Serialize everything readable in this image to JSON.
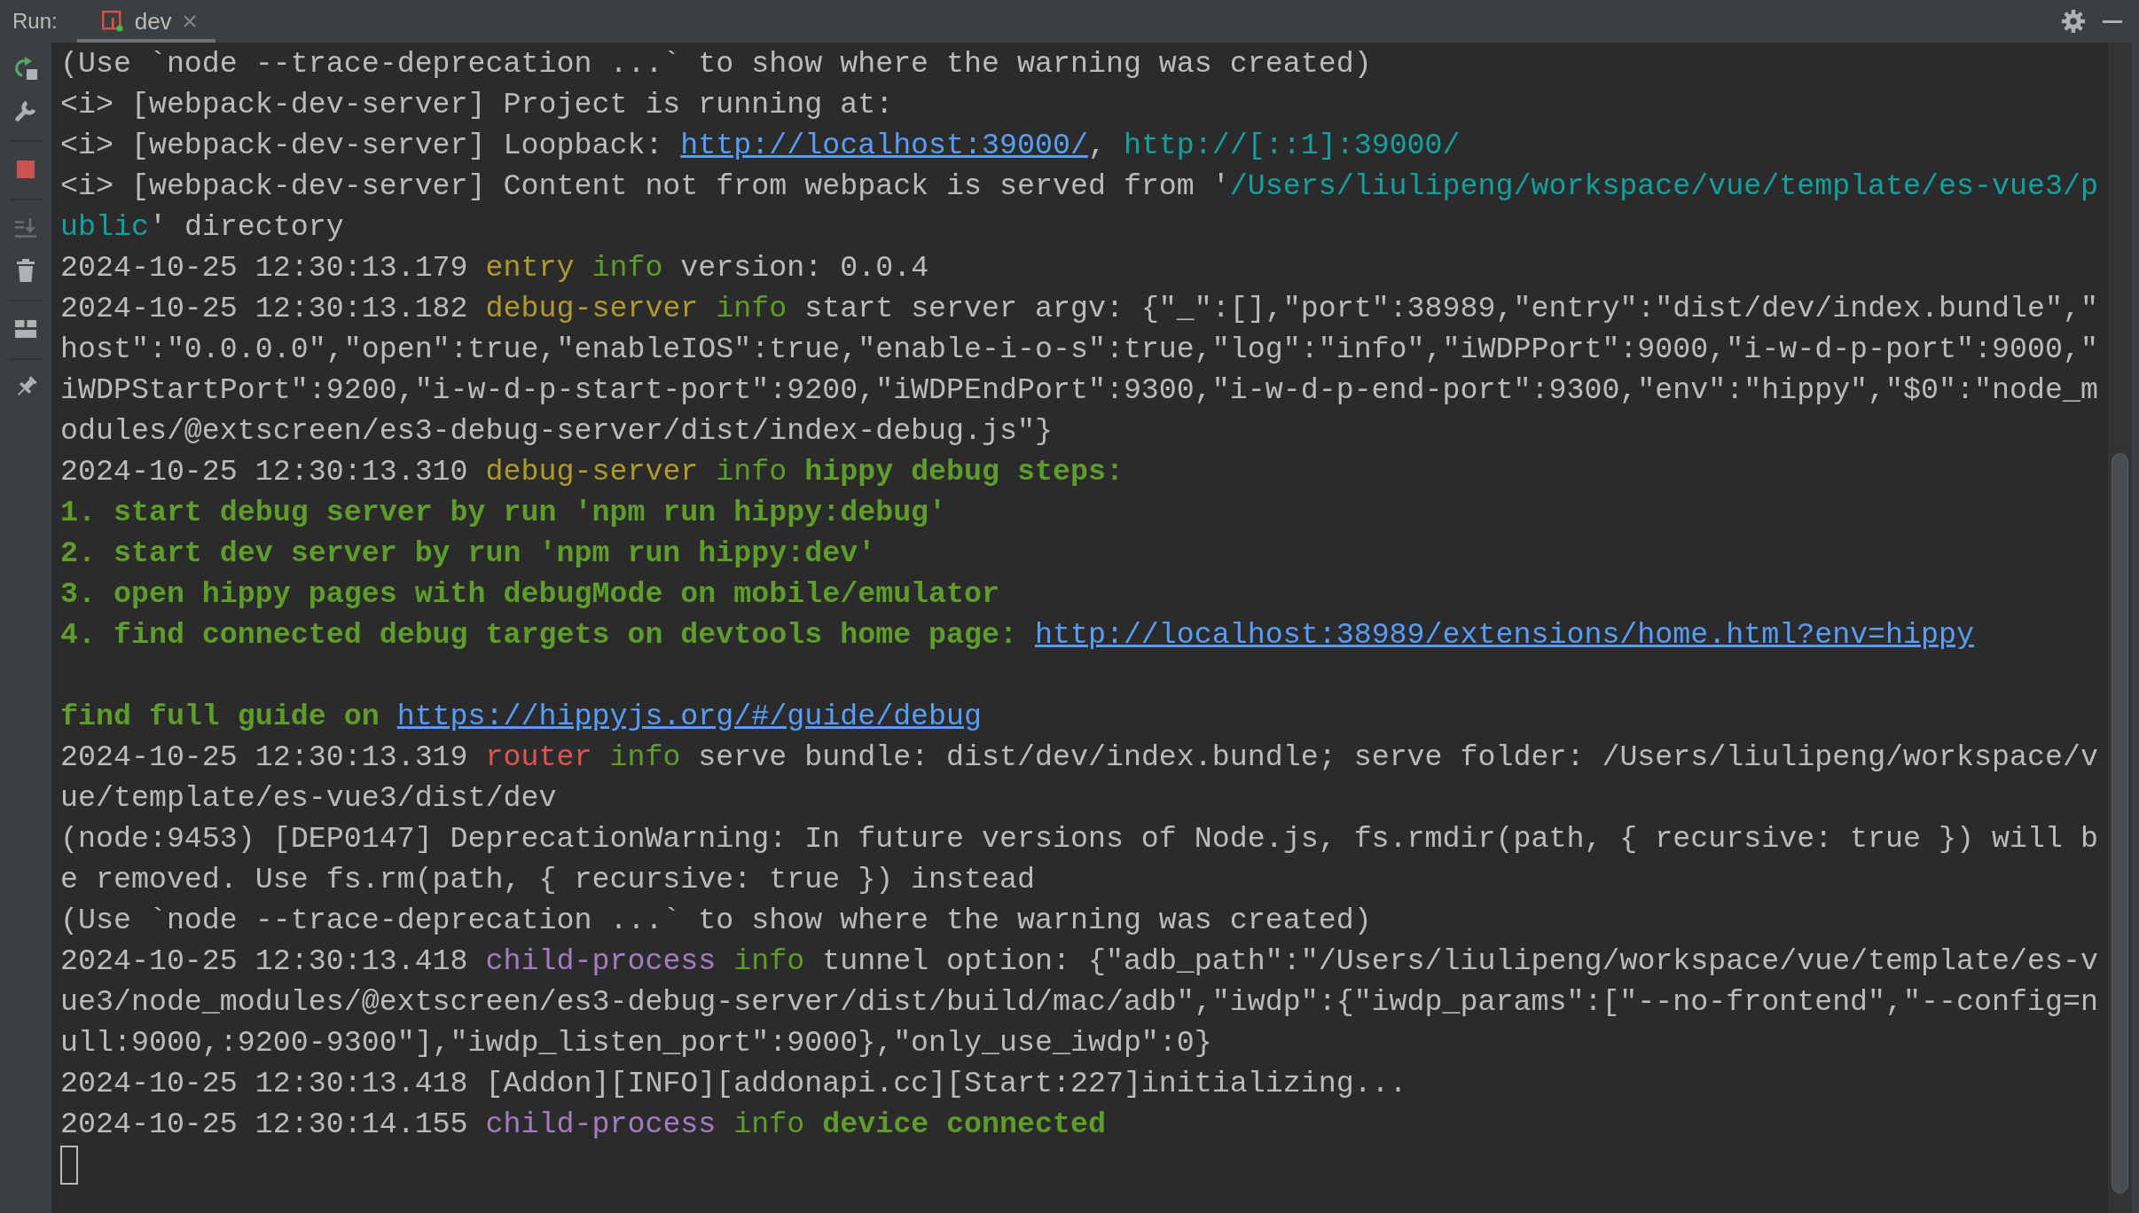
{
  "header": {
    "label": "Run:",
    "tabs": [
      {
        "label": "dev",
        "selected": true
      }
    ]
  },
  "toolbar": {
    "groups": [
      [
        {
          "kind": "rerun",
          "disabled": false
        },
        {
          "kind": "wrench",
          "disabled": false
        }
      ],
      [
        {
          "kind": "stop",
          "disabled": false
        }
      ],
      [
        {
          "kind": "scroll_end",
          "disabled": true
        },
        {
          "kind": "clear",
          "disabled": false
        }
      ],
      [
        {
          "kind": "layout",
          "disabled": false
        }
      ],
      [
        {
          "kind": "pin",
          "disabled": false
        }
      ]
    ]
  },
  "console": {
    "rows": [
      {
        "kind": "log",
        "segments": [
          {
            "kind": "text",
            "text": "(Use `node --trace-deprecation ...` to show where the warning was created)"
          }
        ]
      },
      {
        "kind": "log",
        "segments": [
          {
            "kind": "text",
            "text": "<i> [webpack-dev-server] Project is running at:"
          }
        ]
      },
      {
        "kind": "log",
        "segments": [
          {
            "kind": "text",
            "text": "<i> [webpack-dev-server] Loopback: "
          },
          {
            "kind": "link",
            "text": "http://localhost:39000/"
          },
          {
            "kind": "text",
            "text": ", "
          },
          {
            "kind": "text",
            "text": "http://[::1]:39000/",
            "color": "#15a0a0"
          }
        ]
      },
      {
        "kind": "log",
        "segments": [
          {
            "kind": "text",
            "text": "<i> [webpack-dev-server] Content not from webpack is served from '"
          },
          {
            "kind": "text",
            "text": "/Users/liulipeng/workspace/vue/template/es-vue3/p",
            "color": "#15a0a0"
          }
        ]
      },
      {
        "kind": "log",
        "segments": [
          {
            "kind": "text",
            "text": "ublic",
            "color": "#15a0a0"
          },
          {
            "kind": "text",
            "text": "' directory"
          }
        ]
      },
      {
        "kind": "log",
        "segments": [
          {
            "kind": "text",
            "text": "2024-10-25 12:30:13.179 "
          },
          {
            "kind": "text",
            "text": "entry ",
            "color": "#b09a2e"
          },
          {
            "kind": "text",
            "text": "info",
            "color": "#5e9c2b"
          },
          {
            "kind": "text",
            "text": " version: 0.0.4"
          }
        ]
      },
      {
        "kind": "log",
        "segments": [
          {
            "kind": "text",
            "text": "2024-10-25 12:30:13.182 "
          },
          {
            "kind": "text",
            "text": "debug-server ",
            "color": "#b09a2e"
          },
          {
            "kind": "text",
            "text": "info",
            "color": "#5e9c2b"
          },
          {
            "kind": "text",
            "text": " start server argv: {\"_\":[],\"port\":38989,\"entry\":\"dist/dev/index.bundle\",\""
          }
        ]
      },
      {
        "kind": "log",
        "segments": [
          {
            "kind": "text",
            "text": "host\":\"0.0.0.0\",\"open\":true,\"enableIOS\":true,\"enable-i-o-s\":true,\"log\":\"info\",\"iWDPPort\":9000,\"i-w-d-p-port\":9000,\""
          }
        ]
      },
      {
        "kind": "log",
        "segments": [
          {
            "kind": "text",
            "text": "iWDPStartPort\":9200,\"i-w-d-p-start-port\":9200,\"iWDPEndPort\":9300,\"i-w-d-p-end-port\":9300,\"env\":\"hippy\",\"$0\":\"node_m"
          }
        ]
      },
      {
        "kind": "log",
        "segments": [
          {
            "kind": "text",
            "text": "odules/@extscreen/es3-debug-server/dist/index-debug.js\"}"
          }
        ]
      },
      {
        "kind": "log",
        "segments": [
          {
            "kind": "text",
            "text": "2024-10-25 12:30:13.310 "
          },
          {
            "kind": "text",
            "text": "debug-server ",
            "color": "#b09a2e"
          },
          {
            "kind": "text",
            "text": "info ",
            "color": "#5e9c2b"
          },
          {
            "kind": "strong",
            "text": "hippy debug steps:",
            "color": "#5e9c2b"
          }
        ]
      },
      {
        "kind": "log",
        "segments": [
          {
            "kind": "strong",
            "text": "1. start debug server by run 'npm run hippy:debug'",
            "color": "#5e9c2b"
          }
        ]
      },
      {
        "kind": "log",
        "segments": [
          {
            "kind": "strong",
            "text": "2. start dev server by run 'npm run hippy:dev'",
            "color": "#5e9c2b"
          }
        ]
      },
      {
        "kind": "log",
        "segments": [
          {
            "kind": "strong",
            "text": "3. open hippy pages with debugMode on mobile/emulator",
            "color": "#5e9c2b"
          }
        ]
      },
      {
        "kind": "log",
        "segments": [
          {
            "kind": "strong",
            "text": "4. find connected debug targets on devtools home page: ",
            "color": "#5e9c2b"
          },
          {
            "kind": "link",
            "text": "http://localhost:38989/extensions/home.html?env=hippy"
          }
        ]
      },
      {
        "kind": "blank"
      },
      {
        "kind": "log",
        "segments": [
          {
            "kind": "strong",
            "text": "find full guide on ",
            "color": "#5e9c2b"
          },
          {
            "kind": "link",
            "text": "https://hippyjs.org/#/guide/debug"
          }
        ]
      },
      {
        "kind": "log",
        "segments": [
          {
            "kind": "text",
            "text": "2024-10-25 12:30:13.319 "
          },
          {
            "kind": "text",
            "text": "router ",
            "color": "#e0534f"
          },
          {
            "kind": "text",
            "text": "info",
            "color": "#5e9c2b"
          },
          {
            "kind": "text",
            "text": " serve bundle: dist/dev/index.bundle; serve folder: /Users/liulipeng/workspace/v"
          }
        ]
      },
      {
        "kind": "log",
        "segments": [
          {
            "kind": "text",
            "text": "ue/template/es-vue3/dist/dev"
          }
        ]
      },
      {
        "kind": "log",
        "segments": [
          {
            "kind": "text",
            "text": "(node:9453) [DEP0147] DeprecationWarning: In future versions of Node.js, fs.rmdir(path, { recursive: true }) will b"
          }
        ]
      },
      {
        "kind": "log",
        "segments": [
          {
            "kind": "text",
            "text": "e removed. Use fs.rm(path, { recursive: true }) instead"
          }
        ]
      },
      {
        "kind": "log",
        "segments": [
          {
            "kind": "text",
            "text": "(Use `node --trace-deprecation ...` to show where the warning was created)"
          }
        ]
      },
      {
        "kind": "log",
        "segments": [
          {
            "kind": "text",
            "text": "2024-10-25 12:30:13.418 "
          },
          {
            "kind": "text",
            "text": "child-process ",
            "color": "#a57cc4"
          },
          {
            "kind": "text",
            "text": "info",
            "color": "#5e9c2b"
          },
          {
            "kind": "text",
            "text": " tunnel option: {\"adb_path\":\"/Users/liulipeng/workspace/vue/template/es-v"
          }
        ]
      },
      {
        "kind": "log",
        "segments": [
          {
            "kind": "text",
            "text": "ue3/node_modules/@extscreen/es3-debug-server/dist/build/mac/adb\",\"iwdp\":{\"iwdp_params\":[\"--no-frontend\",\"--config=n"
          }
        ]
      },
      {
        "kind": "log",
        "segments": [
          {
            "kind": "text",
            "text": "ull:9000,:9200-9300\"],\"iwdp_listen_port\":9000},\"only_use_iwdp\":0}"
          }
        ]
      },
      {
        "kind": "log",
        "segments": [
          {
            "kind": "text",
            "text": "2024-10-25 12:30:13.418 [Addon][INFO][addonapi.cc][Start:227]initializing..."
          }
        ]
      },
      {
        "kind": "log",
        "segments": [
          {
            "kind": "text",
            "text": "2024-10-25 12:30:14.155 "
          },
          {
            "kind": "text",
            "text": "child-process ",
            "color": "#a57cc4"
          },
          {
            "kind": "text",
            "text": "info ",
            "color": "#5e9c2b"
          },
          {
            "kind": "strong",
            "text": "device connected",
            "color": "#5e9c2b"
          }
        ]
      },
      {
        "kind": "cursor"
      }
    ]
  }
}
